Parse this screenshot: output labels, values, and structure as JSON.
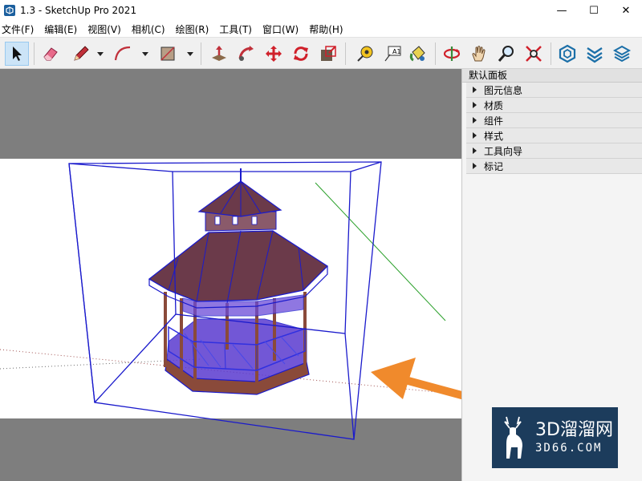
{
  "window": {
    "title": "1.3 - SketchUp Pro 2021",
    "icons": [
      "sketchup-app-icon",
      "minimize-icon",
      "maximize-icon",
      "close-icon"
    ]
  },
  "menu": {
    "items": [
      "文件(F)",
      "编辑(E)",
      "视图(V)",
      "相机(C)",
      "绘图(R)",
      "工具(T)",
      "窗口(W)",
      "帮助(H)"
    ]
  },
  "toolbar": {
    "tools": [
      "select",
      "eraser",
      "pencil-line",
      "arc",
      "rectangle",
      "push-pull",
      "follow-me",
      "move",
      "rotate",
      "scale",
      "tape-measure",
      "text",
      "paint-bucket",
      "orbit",
      "pan",
      "zoom",
      "zoom-extents",
      "warehouse",
      "extension-warehouse",
      "layout"
    ],
    "text_tool_label": "A1"
  },
  "panel": {
    "title": "默认面板",
    "sections": [
      "图元信息",
      "材质",
      "组件",
      "样式",
      "工具向导",
      "标记"
    ]
  },
  "watermark": {
    "brand": "3D溜溜网",
    "url": "3D66.COM"
  },
  "colors": {
    "selection_blue": "#1a1acc",
    "roof": "#6b3a4a",
    "wood": "#8a4a3a",
    "annotation_arrow": "#f08a2c",
    "green_axis": "#2aa02a",
    "watermark_bg": "#1c3c5c"
  }
}
